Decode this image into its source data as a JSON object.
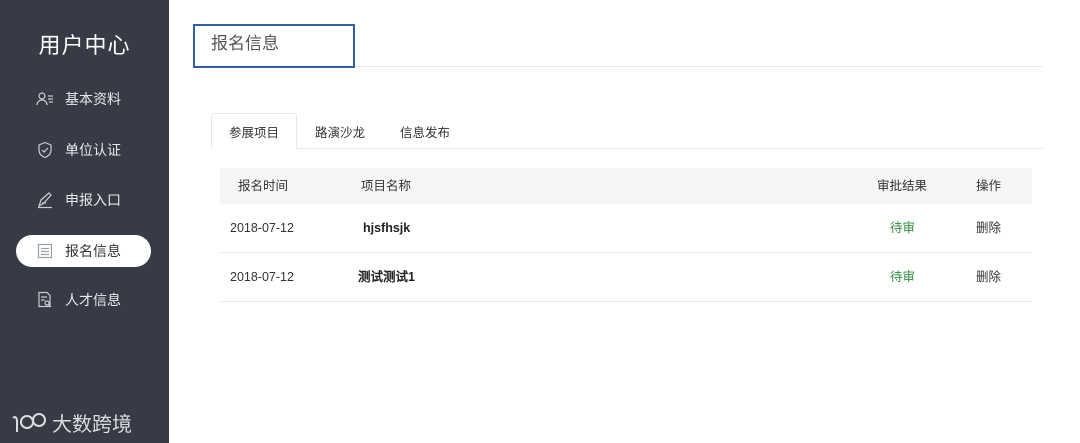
{
  "sidebar": {
    "title": "用户中心",
    "items": [
      {
        "label": "基本资料",
        "icon": "user-list-icon"
      },
      {
        "label": "单位认证",
        "icon": "shield-check-icon"
      },
      {
        "label": "申报入口",
        "icon": "pen-icon"
      },
      {
        "label": "报名信息",
        "icon": "list-document-icon"
      },
      {
        "label": "人才信息",
        "icon": "document-search-icon"
      }
    ]
  },
  "header": {
    "title": "报名信息"
  },
  "tabs": [
    {
      "label": "参展项目"
    },
    {
      "label": "路演沙龙"
    },
    {
      "label": "信息发布"
    }
  ],
  "table": {
    "columns": [
      "报名时间",
      "项目名称",
      "审批结果",
      "操作"
    ],
    "rows": [
      {
        "date": "2018-07-12",
        "name": "hjsfhsjk",
        "status": "待审",
        "action": "删除"
      },
      {
        "date": "2018-07-12",
        "name": "测试测试1",
        "status": "待审",
        "action": "删除"
      }
    ]
  },
  "watermark": {
    "text": "大数跨境"
  },
  "colors": {
    "sidebar_bg": "#363b45",
    "status_pending": "#2f8f3f",
    "highlight_box": "#2f5fab"
  }
}
